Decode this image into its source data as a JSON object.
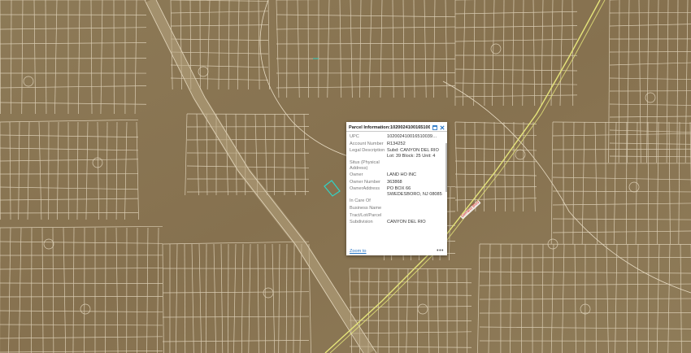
{
  "map": {
    "road_label": "Serrano Blvd",
    "colors": {
      "terrain": "#8a7653",
      "parcel_lines": "#e8dcc4",
      "highlight": "#32d2c4",
      "highway": "#e6e67a"
    }
  },
  "popup": {
    "title": "Parcel Information:102002410016510039…",
    "rows": [
      {
        "label": "UPC",
        "value": "102002410016510039…"
      },
      {
        "label": "Account Number",
        "value": "R134252"
      },
      {
        "label": "Legal Description",
        "value": "Subd: CANYON DEL RIO Lot: 39 Block: 25 Unit: 4"
      },
      {
        "label": "Situs (Physical Address)",
        "value": ""
      },
      {
        "label": "Owner",
        "value": "LAND HO INC"
      },
      {
        "label": "Owner Number",
        "value": "363868"
      },
      {
        "label": "OwnerAddress",
        "value": "PO BOX 66\nSWEDESBORO, NJ 08085"
      },
      {
        "label": "In Care Of",
        "value": ""
      },
      {
        "label": "Business Name",
        "value": ""
      },
      {
        "label": "Tract/Lot/Parcel",
        "value": ""
      },
      {
        "label": "Subdivision",
        "value": "CANYON DEL RIO"
      }
    ],
    "zoom_label": "Zoom to",
    "more_label": "•••"
  }
}
